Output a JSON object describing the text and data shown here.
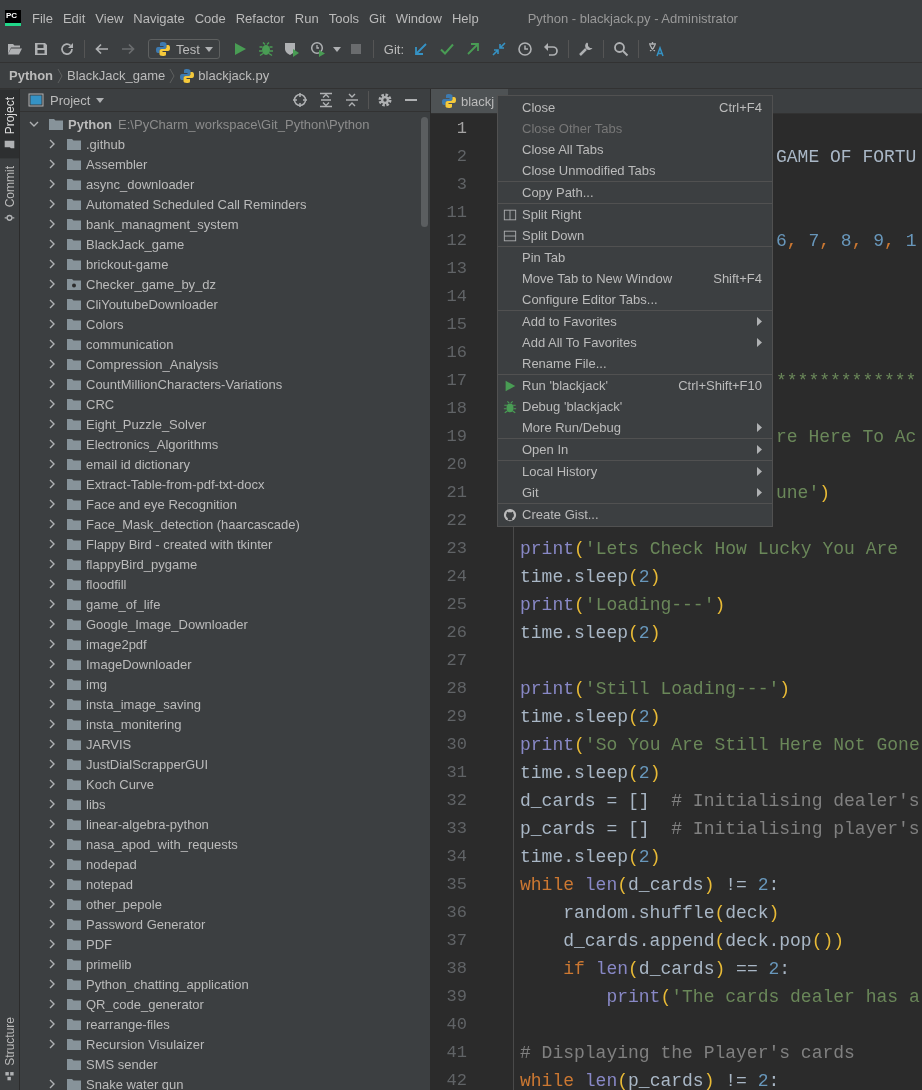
{
  "menu_bar": {
    "logo": "PC",
    "items": [
      "File",
      "Edit",
      "View",
      "Navigate",
      "Code",
      "Refactor",
      "Run",
      "Tools",
      "Git",
      "Window",
      "Help"
    ],
    "title": "Python - blackjack.py - Administrator"
  },
  "toolbar": [
    {
      "kind": "open",
      "disabled": false
    },
    {
      "kind": "save",
      "disabled": false
    },
    {
      "kind": "sync",
      "disabled": false
    },
    {
      "kind": "separator"
    },
    {
      "kind": "back",
      "disabled": false
    },
    {
      "kind": "forward",
      "disabled": true
    },
    {
      "kind": "run_config",
      "label": "Test"
    },
    {
      "kind": "run",
      "disabled": false
    },
    {
      "kind": "debug",
      "disabled": false
    },
    {
      "kind": "coverage",
      "disabled": false
    },
    {
      "kind": "profile",
      "disabled": false
    },
    {
      "kind": "dropdown"
    },
    {
      "kind": "stop",
      "disabled": true
    },
    {
      "kind": "separator"
    },
    {
      "kind": "label",
      "label": "Git:"
    },
    {
      "kind": "update",
      "disabled": false
    },
    {
      "kind": "commit",
      "disabled": false
    },
    {
      "kind": "push",
      "disabled": false
    },
    {
      "kind": "merge",
      "disabled": false
    },
    {
      "kind": "history",
      "disabled": false
    },
    {
      "kind": "rollback",
      "disabled": false
    },
    {
      "kind": "separator"
    },
    {
      "kind": "wrench",
      "disabled": false
    },
    {
      "kind": "separator"
    },
    {
      "kind": "search",
      "disabled": false
    },
    {
      "kind": "separator"
    },
    {
      "kind": "translate",
      "disabled": false
    }
  ],
  "breadcrumb": [
    {
      "label": "Python",
      "kind": "root"
    },
    {
      "label": "BlackJack_game",
      "kind": "folder"
    },
    {
      "label": "blackjack.py",
      "kind": "file"
    }
  ],
  "tool_stripe": {
    "top": [
      {
        "label": "Project",
        "kind": "project",
        "selected": true
      },
      {
        "label": "Commit",
        "kind": "commit",
        "selected": false
      }
    ],
    "bottom": [
      {
        "label": "Structure",
        "kind": "structure",
        "selected": false
      }
    ]
  },
  "project_panel": {
    "title": "Project",
    "root": {
      "name": "Python",
      "path": "E:\\PyCharm_workspace\\Git_Python\\Python",
      "expanded": true,
      "children": [
        {
          "name": ".github",
          "kind": "folder",
          "expandable": true
        },
        {
          "name": "Assembler",
          "kind": "folder",
          "expandable": true
        },
        {
          "name": "async_downloader",
          "kind": "folder",
          "expandable": true
        },
        {
          "name": "Automated Scheduled Call Reminders",
          "kind": "folder",
          "expandable": true
        },
        {
          "name": "bank_managment_system",
          "kind": "folder",
          "expandable": true
        },
        {
          "name": "BlackJack_game",
          "kind": "folder",
          "expandable": true
        },
        {
          "name": "brickout-game",
          "kind": "folder",
          "expandable": true
        },
        {
          "name": "Checker_game_by_dz",
          "kind": "module",
          "expandable": true
        },
        {
          "name": "CliYoutubeDownloader",
          "kind": "folder",
          "expandable": true
        },
        {
          "name": "Colors",
          "kind": "folder",
          "expandable": true
        },
        {
          "name": "communication",
          "kind": "folder",
          "expandable": true
        },
        {
          "name": "Compression_Analysis",
          "kind": "folder",
          "expandable": true
        },
        {
          "name": "CountMillionCharacters-Variations",
          "kind": "folder",
          "expandable": true
        },
        {
          "name": "CRC",
          "kind": "folder",
          "expandable": true
        },
        {
          "name": "Eight_Puzzle_Solver",
          "kind": "folder",
          "expandable": true
        },
        {
          "name": "Electronics_Algorithms",
          "kind": "folder",
          "expandable": true
        },
        {
          "name": "email id dictionary",
          "kind": "folder",
          "expandable": true
        },
        {
          "name": "Extract-Table-from-pdf-txt-docx",
          "kind": "folder",
          "expandable": true
        },
        {
          "name": "Face and eye Recognition",
          "kind": "folder",
          "expandable": true
        },
        {
          "name": "Face_Mask_detection (haarcascade)",
          "kind": "folder",
          "expandable": true
        },
        {
          "name": "Flappy Bird - created with tkinter",
          "kind": "folder",
          "expandable": true
        },
        {
          "name": "flappyBird_pygame",
          "kind": "folder",
          "expandable": true
        },
        {
          "name": "floodfill",
          "kind": "folder",
          "expandable": true
        },
        {
          "name": "game_of_life",
          "kind": "folder",
          "expandable": true
        },
        {
          "name": "Google_Image_Downloader",
          "kind": "folder",
          "expandable": true
        },
        {
          "name": "image2pdf",
          "kind": "folder",
          "expandable": true
        },
        {
          "name": "ImageDownloader",
          "kind": "folder",
          "expandable": true
        },
        {
          "name": "img",
          "kind": "folder",
          "expandable": true
        },
        {
          "name": "insta_image_saving",
          "kind": "folder",
          "expandable": true
        },
        {
          "name": "insta_monitering",
          "kind": "folder",
          "expandable": true
        },
        {
          "name": "JARVIS",
          "kind": "folder",
          "expandable": true
        },
        {
          "name": "JustDialScrapperGUI",
          "kind": "folder",
          "expandable": true
        },
        {
          "name": "Koch Curve",
          "kind": "folder",
          "expandable": true
        },
        {
          "name": "libs",
          "kind": "folder",
          "expandable": true
        },
        {
          "name": "linear-algebra-python",
          "kind": "folder",
          "expandable": true
        },
        {
          "name": "nasa_apod_with_requests",
          "kind": "folder",
          "expandable": true
        },
        {
          "name": "nodepad",
          "kind": "folder",
          "expandable": true
        },
        {
          "name": "notepad",
          "kind": "folder",
          "expandable": true
        },
        {
          "name": "other_pepole",
          "kind": "folder",
          "expandable": true
        },
        {
          "name": "Password Generator",
          "kind": "folder",
          "expandable": true
        },
        {
          "name": "PDF",
          "kind": "folder",
          "expandable": true
        },
        {
          "name": "primelib",
          "kind": "folder",
          "expandable": true
        },
        {
          "name": "Python_chatting_application",
          "kind": "folder",
          "expandable": true
        },
        {
          "name": "QR_code_generator",
          "kind": "folder",
          "expandable": true
        },
        {
          "name": "rearrange-files",
          "kind": "folder",
          "expandable": true
        },
        {
          "name": "Recursion Visulaizer",
          "kind": "folder",
          "expandable": true
        },
        {
          "name": "SMS sender",
          "kind": "folder",
          "expandable": false
        },
        {
          "name": "Snake water gun",
          "kind": "folder",
          "expandable": true
        }
      ]
    }
  },
  "editor": {
    "tab": {
      "label": "blackj",
      "selected": true
    },
    "lines": [
      {
        "number": "1",
        "current": true
      },
      {
        "number": "2",
        "current": false,
        "kind": "partial",
        "tokens": [
          {
            "kind": "plain",
            "text": "GAME OF FORTU"
          }
        ]
      },
      {
        "number": "3",
        "current": false
      },
      {
        "number": "11",
        "current": false
      },
      {
        "number": "12",
        "current": false,
        "kind": "partial",
        "tokens": [
          {
            "kind": "number",
            "text": "6"
          },
          {
            "kind": "punct",
            "text": ", "
          },
          {
            "kind": "number",
            "text": "7"
          },
          {
            "kind": "punct",
            "text": ", "
          },
          {
            "kind": "number",
            "text": "8"
          },
          {
            "kind": "punct",
            "text": ", "
          },
          {
            "kind": "number",
            "text": "9"
          },
          {
            "kind": "punct",
            "text": ", "
          },
          {
            "kind": "number",
            "text": "1"
          }
        ]
      },
      {
        "number": "13",
        "current": false
      },
      {
        "number": "14",
        "current": false
      },
      {
        "number": "15",
        "current": false
      },
      {
        "number": "16",
        "current": false
      },
      {
        "number": "17",
        "current": false,
        "kind": "partial",
        "tokens": [
          {
            "kind": "string",
            "text": "*************"
          }
        ]
      },
      {
        "number": "18",
        "current": false
      },
      {
        "number": "19",
        "current": false,
        "kind": "partial",
        "tokens": [
          {
            "kind": "string",
            "text": "re Here To Ac"
          }
        ]
      },
      {
        "number": "20",
        "current": false
      },
      {
        "number": "21",
        "current": false,
        "kind": "partial",
        "tokens": [
          {
            "kind": "string",
            "text": "une'"
          },
          {
            "kind": "paren",
            "text": ")"
          }
        ]
      },
      {
        "number": "22",
        "current": false
      },
      {
        "number": "23",
        "current": false,
        "kind": "code",
        "tokens": [
          {
            "kind": "builtin",
            "text": "print"
          },
          {
            "kind": "paren",
            "text": "("
          },
          {
            "kind": "string",
            "text": "'Lets Check How Lucky You Are"
          }
        ]
      },
      {
        "number": "24",
        "current": false,
        "kind": "code",
        "tokens": [
          {
            "kind": "plain",
            "text": "time.sleep"
          },
          {
            "kind": "paren",
            "text": "("
          },
          {
            "kind": "number",
            "text": "2"
          },
          {
            "kind": "paren",
            "text": ")"
          }
        ]
      },
      {
        "number": "25",
        "current": false,
        "kind": "code",
        "tokens": [
          {
            "kind": "builtin",
            "text": "print"
          },
          {
            "kind": "paren",
            "text": "("
          },
          {
            "kind": "string",
            "text": "'Loading---'"
          },
          {
            "kind": "paren",
            "text": ")"
          }
        ]
      },
      {
        "number": "26",
        "current": false,
        "kind": "code",
        "tokens": [
          {
            "kind": "plain",
            "text": "time.sleep"
          },
          {
            "kind": "paren",
            "text": "("
          },
          {
            "kind": "number",
            "text": "2"
          },
          {
            "kind": "paren",
            "text": ")"
          }
        ]
      },
      {
        "number": "27",
        "current": false
      },
      {
        "number": "28",
        "current": false,
        "kind": "code",
        "tokens": [
          {
            "kind": "builtin",
            "text": "print"
          },
          {
            "kind": "paren",
            "text": "("
          },
          {
            "kind": "string",
            "text": "'Still Loading---'"
          },
          {
            "kind": "paren",
            "text": ")"
          }
        ]
      },
      {
        "number": "29",
        "current": false,
        "kind": "code",
        "tokens": [
          {
            "kind": "plain",
            "text": "time.sleep"
          },
          {
            "kind": "paren",
            "text": "("
          },
          {
            "kind": "number",
            "text": "2"
          },
          {
            "kind": "paren",
            "text": ")"
          }
        ]
      },
      {
        "number": "30",
        "current": false,
        "kind": "code",
        "tokens": [
          {
            "kind": "builtin",
            "text": "print"
          },
          {
            "kind": "paren",
            "text": "("
          },
          {
            "kind": "string",
            "text": "'So You Are Still Here Not Gone"
          }
        ]
      },
      {
        "number": "31",
        "current": false,
        "kind": "code",
        "tokens": [
          {
            "kind": "plain",
            "text": "time.sleep"
          },
          {
            "kind": "paren",
            "text": "("
          },
          {
            "kind": "number",
            "text": "2"
          },
          {
            "kind": "paren",
            "text": ")"
          }
        ]
      },
      {
        "number": "32",
        "current": false,
        "kind": "code",
        "tokens": [
          {
            "kind": "plain",
            "text": "d_cards = []  "
          },
          {
            "kind": "comment",
            "text": "# Initialising dealer's"
          }
        ]
      },
      {
        "number": "33",
        "current": false,
        "kind": "code",
        "tokens": [
          {
            "kind": "plain",
            "text": "p_cards = []  "
          },
          {
            "kind": "comment",
            "text": "# Initialising player's"
          }
        ]
      },
      {
        "number": "34",
        "current": false,
        "kind": "code",
        "tokens": [
          {
            "kind": "plain",
            "text": "time.sleep"
          },
          {
            "kind": "paren",
            "text": "("
          },
          {
            "kind": "number",
            "text": "2"
          },
          {
            "kind": "paren",
            "text": ")"
          }
        ]
      },
      {
        "number": "35",
        "current": false,
        "kind": "code",
        "tokens": [
          {
            "kind": "keyword",
            "text": "while "
          },
          {
            "kind": "builtin",
            "text": "len"
          },
          {
            "kind": "paren",
            "text": "("
          },
          {
            "kind": "plain",
            "text": "d_cards"
          },
          {
            "kind": "paren",
            "text": ")"
          },
          {
            "kind": "plain",
            "text": " != "
          },
          {
            "kind": "number",
            "text": "2"
          },
          {
            "kind": "plain",
            "text": ":"
          }
        ]
      },
      {
        "number": "36",
        "current": false,
        "kind": "code",
        "tokens": [
          {
            "kind": "plain",
            "text": "    random.shuffle"
          },
          {
            "kind": "paren",
            "text": "("
          },
          {
            "kind": "plain",
            "text": "deck"
          },
          {
            "kind": "paren",
            "text": ")"
          }
        ]
      },
      {
        "number": "37",
        "current": false,
        "kind": "code",
        "tokens": [
          {
            "kind": "plain",
            "text": "    d_cards.append"
          },
          {
            "kind": "paren",
            "text": "("
          },
          {
            "kind": "plain",
            "text": "deck.pop"
          },
          {
            "kind": "paren",
            "text": "())"
          }
        ]
      },
      {
        "number": "38",
        "current": false,
        "kind": "code",
        "tokens": [
          {
            "kind": "keyword",
            "text": "    if "
          },
          {
            "kind": "builtin",
            "text": "len"
          },
          {
            "kind": "paren",
            "text": "("
          },
          {
            "kind": "plain",
            "text": "d_cards"
          },
          {
            "kind": "paren",
            "text": ")"
          },
          {
            "kind": "plain",
            "text": " == "
          },
          {
            "kind": "number",
            "text": "2"
          },
          {
            "kind": "plain",
            "text": ":"
          }
        ]
      },
      {
        "number": "39",
        "current": false,
        "kind": "code",
        "tokens": [
          {
            "kind": "builtin",
            "text": "        print"
          },
          {
            "kind": "paren",
            "text": "("
          },
          {
            "kind": "string",
            "text": "'The cards dealer has a"
          }
        ]
      },
      {
        "number": "40",
        "current": false
      },
      {
        "number": "41",
        "current": false,
        "kind": "code",
        "tokens": [
          {
            "kind": "comment",
            "text": "# Displaying the Player's cards"
          }
        ]
      },
      {
        "number": "42",
        "current": false,
        "kind": "code",
        "tokens": [
          {
            "kind": "keyword",
            "text": "while "
          },
          {
            "kind": "builtin",
            "text": "len"
          },
          {
            "kind": "paren",
            "text": "("
          },
          {
            "kind": "plain",
            "text": "p_cards"
          },
          {
            "kind": "paren",
            "text": ")"
          },
          {
            "kind": "plain",
            "text": " != "
          },
          {
            "kind": "number",
            "text": "2"
          },
          {
            "kind": "plain",
            "text": ":"
          }
        ]
      }
    ]
  },
  "context_menu": {
    "groups": [
      [
        {
          "label": "Close",
          "kind": "plain",
          "shortcut": "Ctrl+F4",
          "disabled": false,
          "submenu": false
        },
        {
          "label": "Close Other Tabs",
          "kind": "plain",
          "disabled": true,
          "submenu": false
        },
        {
          "label": "Close All Tabs",
          "kind": "plain",
          "disabled": false,
          "submenu": false
        },
        {
          "label": "Close Unmodified Tabs",
          "kind": "plain",
          "disabled": false,
          "submenu": false
        }
      ],
      [
        {
          "label": "Copy Path...",
          "kind": "plain",
          "disabled": false,
          "submenu": false
        }
      ],
      [
        {
          "label": "Split Right",
          "kind": "split_right",
          "disabled": false,
          "submenu": false
        },
        {
          "label": "Split Down",
          "kind": "split_down",
          "disabled": false,
          "submenu": false
        }
      ],
      [
        {
          "label": "Pin Tab",
          "kind": "plain",
          "disabled": false,
          "submenu": false
        },
        {
          "label": "Move Tab to New Window",
          "kind": "plain",
          "shortcut": "Shift+F4",
          "disabled": false,
          "submenu": false
        },
        {
          "label": "Configure Editor Tabs...",
          "kind": "plain",
          "disabled": false,
          "submenu": false
        }
      ],
      [
        {
          "label": "Add to Favorites",
          "kind": "plain",
          "disabled": false,
          "submenu": true
        },
        {
          "label": "Add All To Favorites",
          "kind": "plain",
          "disabled": false,
          "submenu": true
        },
        {
          "label": "Rename File...",
          "kind": "plain",
          "disabled": false,
          "submenu": false
        }
      ],
      [
        {
          "label": "Run 'blackjack'",
          "kind": "run",
          "shortcut": "Ctrl+Shift+F10",
          "disabled": false,
          "submenu": false
        },
        {
          "label": "Debug 'blackjack'",
          "kind": "debug",
          "disabled": false,
          "submenu": false
        },
        {
          "label": "More Run/Debug",
          "kind": "plain",
          "disabled": false,
          "submenu": true
        }
      ],
      [
        {
          "label": "Open In",
          "kind": "plain",
          "disabled": false,
          "submenu": true
        }
      ],
      [
        {
          "label": "Local History",
          "kind": "plain",
          "disabled": false,
          "submenu": true
        },
        {
          "label": "Git",
          "kind": "plain",
          "disabled": false,
          "submenu": true
        }
      ],
      [
        {
          "label": "Create Gist...",
          "kind": "gist",
          "disabled": false,
          "submenu": false
        }
      ]
    ]
  }
}
